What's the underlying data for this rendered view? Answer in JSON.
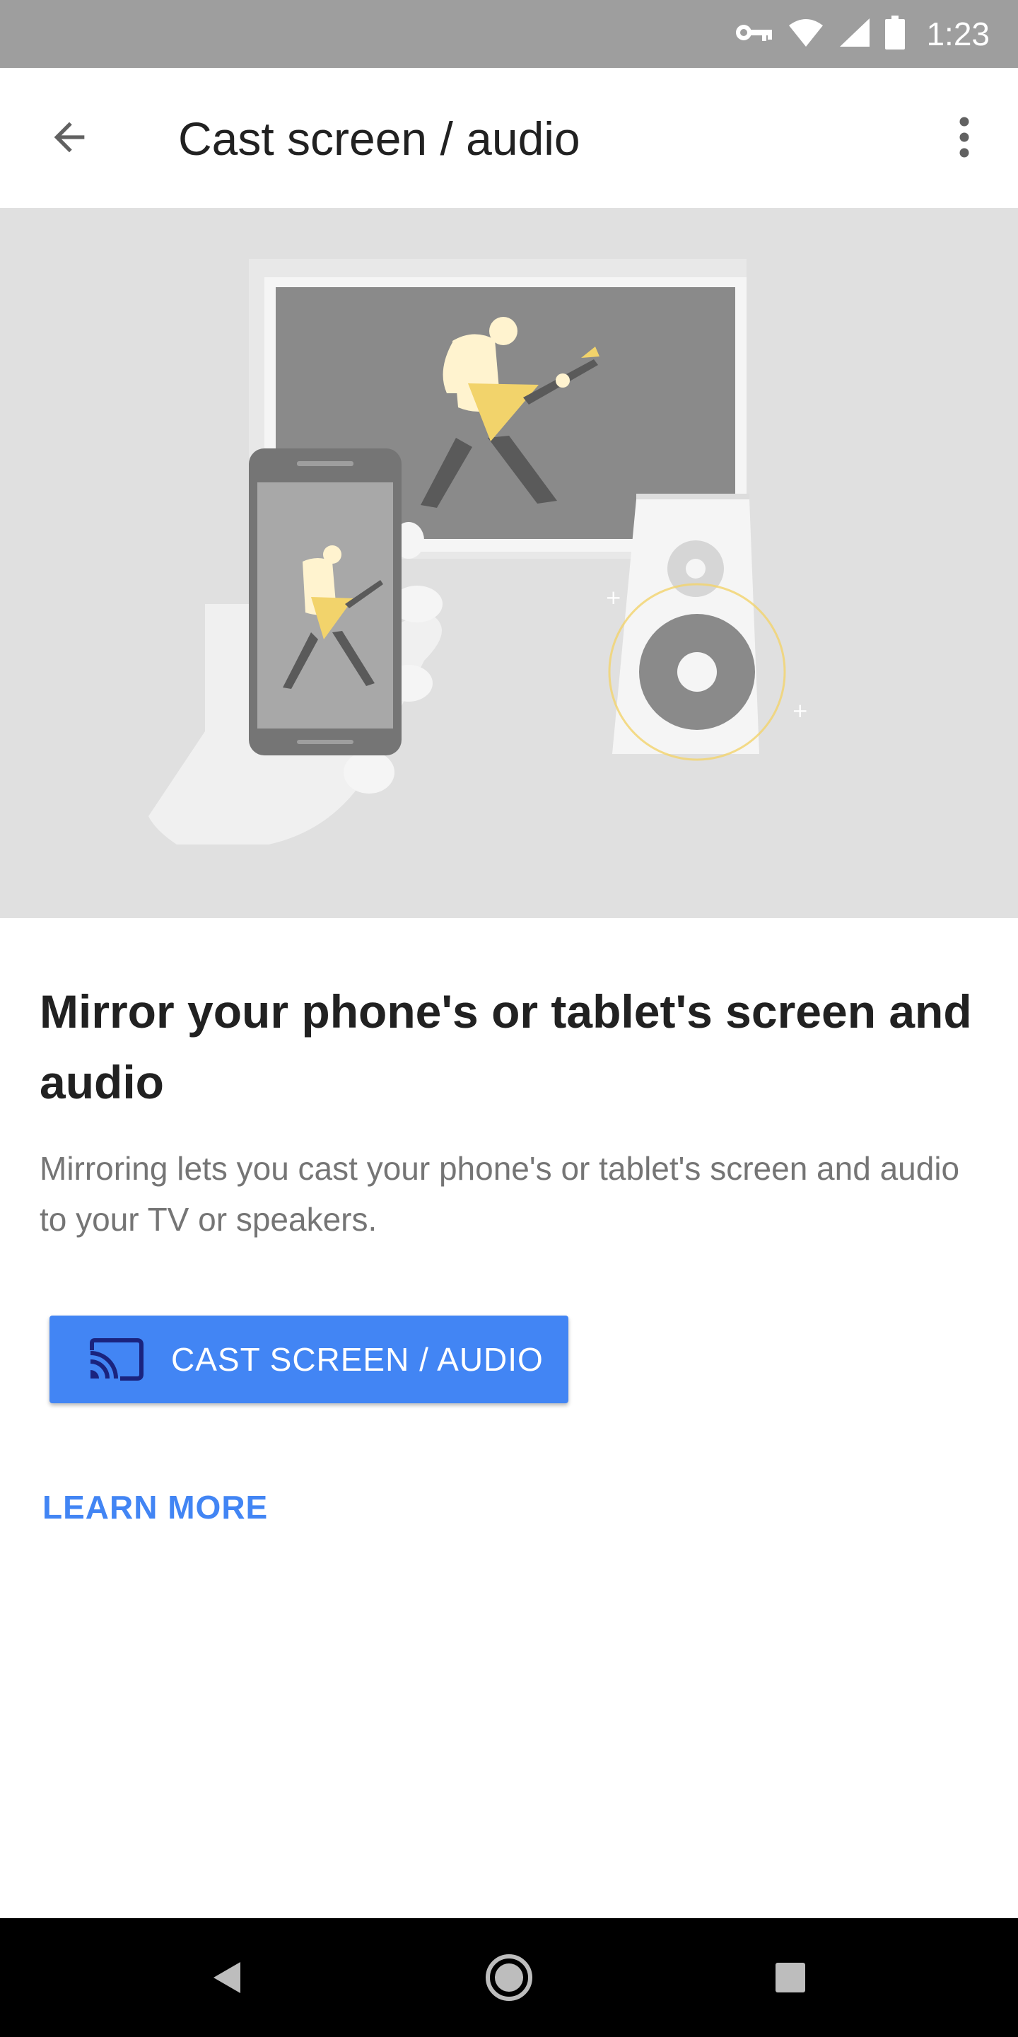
{
  "status_bar": {
    "time": "1:23",
    "icons": [
      "vpn-key-icon",
      "wifi-icon",
      "cellular-signal-icon",
      "battery-icon"
    ]
  },
  "app_bar": {
    "title": "Cast screen / audio",
    "back_icon": "arrow-back-icon",
    "menu_icon": "more-vert-icon"
  },
  "hero": {
    "illustration": "phone-tv-speaker-casting-illustration"
  },
  "content": {
    "heading": "Mirror your phone's or tablet's screen and audio",
    "description": "Mirroring lets you cast your phone's or tablet's screen and audio to your TV or speakers.",
    "cast_button_label": "CAST SCREEN / AUDIO",
    "learn_more_label": "LEARN MORE"
  },
  "nav_bar": {
    "buttons": [
      "back-triangle-icon",
      "home-circle-icon",
      "recents-square-icon"
    ]
  },
  "colors": {
    "accent": "#4285f4",
    "status_bar": "#9e9e9e",
    "hero_background": "#e0e0e0",
    "heading_text": "#212121",
    "body_text": "#757575",
    "illustration_highlight": "#f2d36b"
  }
}
